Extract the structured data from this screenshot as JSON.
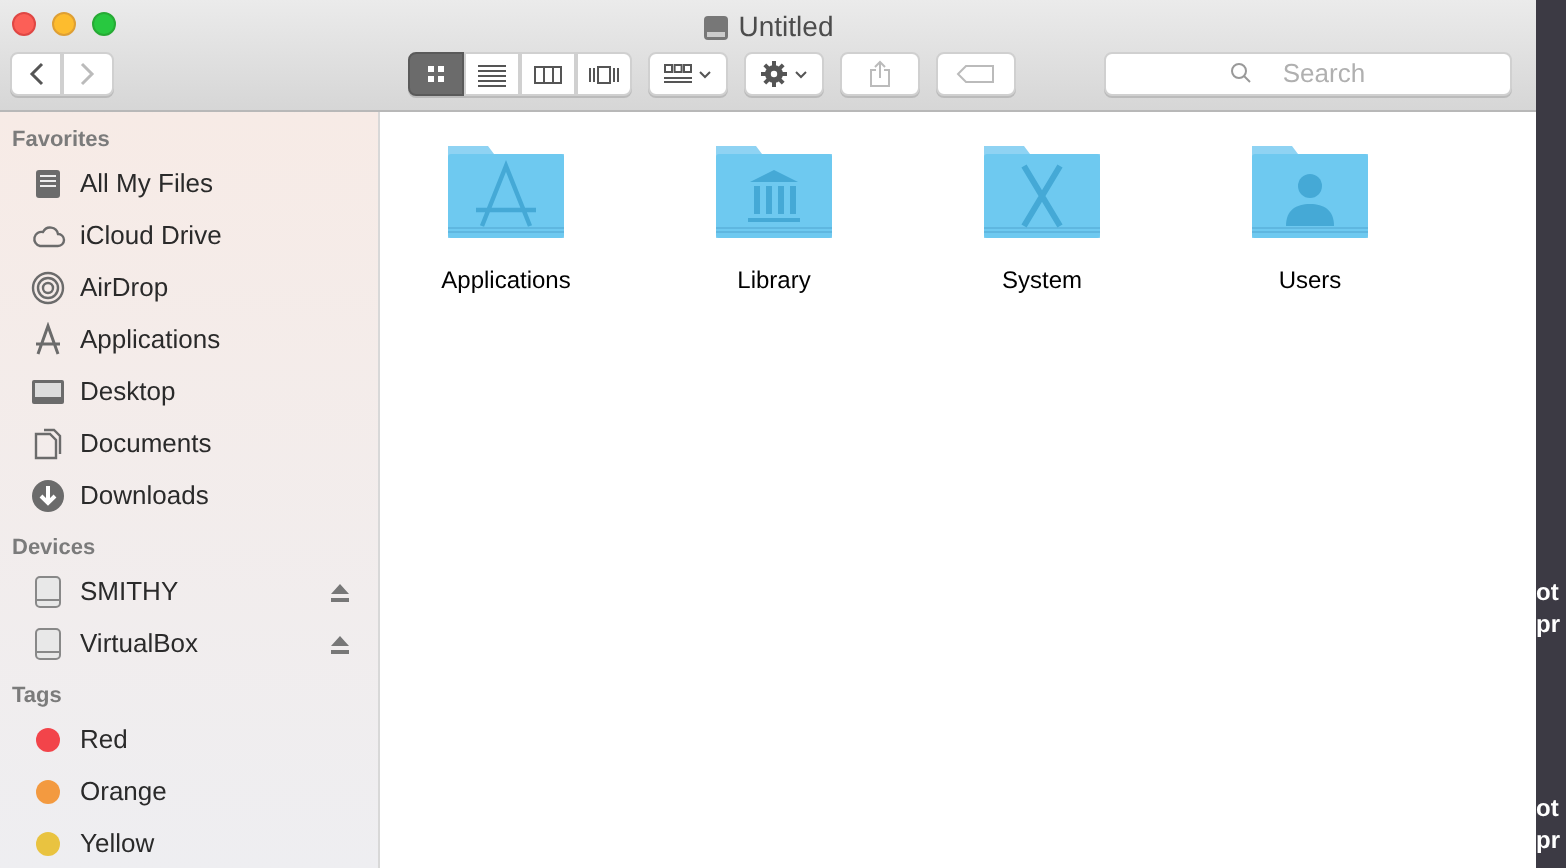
{
  "window": {
    "title": "Untitled"
  },
  "toolbar": {
    "view_modes": [
      {
        "kind": "icons",
        "selected": true
      },
      {
        "kind": "list",
        "selected": false
      },
      {
        "kind": "columns",
        "selected": false
      },
      {
        "kind": "coverflow",
        "selected": false
      }
    ],
    "search": {
      "placeholder": "Search"
    }
  },
  "sidebar": {
    "sections": [
      {
        "title": "Favorites",
        "items": [
          {
            "label": "All My Files",
            "kind": "files"
          },
          {
            "label": "iCloud Drive",
            "kind": "cloud"
          },
          {
            "label": "AirDrop",
            "kind": "airdrop"
          },
          {
            "label": "Applications",
            "kind": "apps"
          },
          {
            "label": "Desktop",
            "kind": "desktop"
          },
          {
            "label": "Documents",
            "kind": "documents"
          },
          {
            "label": "Downloads",
            "kind": "downloads"
          }
        ]
      },
      {
        "title": "Devices",
        "items": [
          {
            "label": "SMITHY",
            "kind": "disk"
          },
          {
            "label": "VirtualBox",
            "kind": "disk"
          }
        ]
      },
      {
        "title": "Tags",
        "items": [
          {
            "label": "Red",
            "kind": "tag",
            "color": "#f2444a"
          },
          {
            "label": "Orange",
            "kind": "tag",
            "color": "#f39a40"
          },
          {
            "label": "Yellow",
            "kind": "tag",
            "color": "#e9c340"
          }
        ]
      }
    ]
  },
  "files": [
    {
      "name": "Applications",
      "kind": "apps"
    },
    {
      "name": "Library",
      "kind": "library"
    },
    {
      "name": "System",
      "kind": "system"
    },
    {
      "name": "Users",
      "kind": "users"
    }
  ],
  "desktop_labels": [
    "ot",
    "pr",
    "ot",
    "pr"
  ]
}
